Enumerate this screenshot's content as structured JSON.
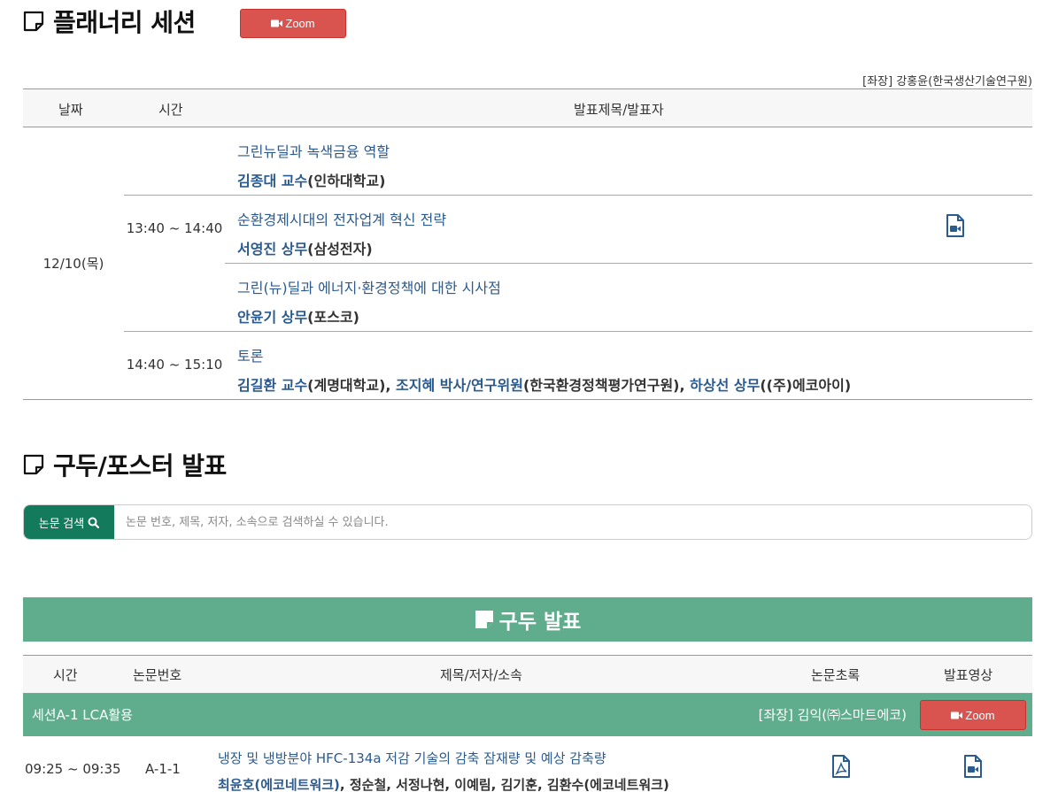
{
  "plenary": {
    "title": "플래너리 세션",
    "zoom_label": "Zoom",
    "chair": "[좌장] 강홍윤(한국생산기술연구원)",
    "headers": {
      "date": "날짜",
      "time": "시간",
      "talk": "발표제목/발표자"
    },
    "date": "12/10(목)",
    "slots": [
      {
        "time": "13:40 ~ 14:40"
      },
      {
        "time": "14:40 ~ 15:10"
      }
    ],
    "talks": [
      {
        "title": "그린뉴딜과 녹색금융 역할",
        "speaker_name": "김종대 교수",
        "speaker_aff": "(인하대학교)"
      },
      {
        "title": "순환경제시대의 전자업계 혁신 전략",
        "speaker_name": "서영진 상무",
        "speaker_aff": "(삼성전자)"
      },
      {
        "title": "그린(뉴)딜과 에너지·환경정책에 대한 시사점",
        "speaker_name": "안윤기 상무",
        "speaker_aff": "(포스코)"
      },
      {
        "title": "토론",
        "speakers": [
          {
            "name": "김길환 교수",
            "aff": "(계명대학교), "
          },
          {
            "name": "조지혜 박사/연구위원",
            "aff": "(한국환경정책평가연구원), "
          },
          {
            "name": "하상선 상무",
            "aff": "((주)에코아이)"
          }
        ]
      }
    ],
    "video_icon": "video-file-icon"
  },
  "oral_section": {
    "title": "구두/포스터 발표",
    "search": {
      "button_label": "논문 검색",
      "placeholder": "논문 번호, 제목, 저자, 소속으로 검색하실 수 있습니다."
    },
    "banner": "구두 발표",
    "headers": {
      "time": "시간",
      "paper_no": "논문번호",
      "title": "제목/저자/소속",
      "abstract": "논문초록",
      "video": "발표영상"
    },
    "session": {
      "name": "세션A-1 LCA활용",
      "chair": "[좌장] 김익(㈜스마트에코)",
      "zoom_label": "Zoom"
    },
    "papers": [
      {
        "time": "09:25 ~ 09:35",
        "no": "A-1-1",
        "title": "냉장 및 냉방분야 HFC-134a 저감 기술의 감축 잠재량 및 예상 감축량",
        "presenter": "최윤호(에코네트워크)",
        "coauthors": ", 정순철, 서정나현, 이예림, 김기훈, 김환수(에코네트워크)"
      }
    ]
  },
  "colors": {
    "accent_green": "#5fad8c",
    "search_green": "#147a5c",
    "zoom_red": "#d9534f",
    "link_blue": "#2b5a8f"
  }
}
